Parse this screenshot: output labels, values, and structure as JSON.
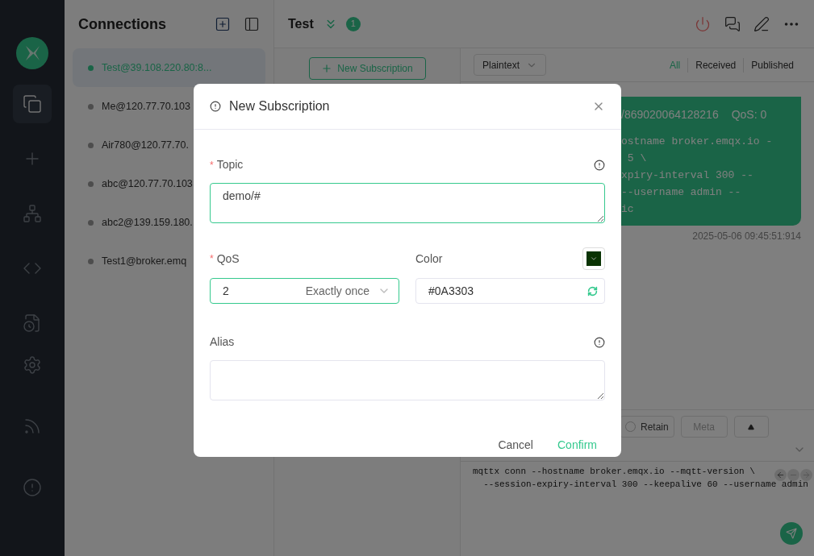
{
  "sidebar": {
    "items": [
      {
        "selected": true
      },
      {
        "selected": false
      },
      {
        "selected": false
      },
      {
        "selected": false
      },
      {
        "selected": false
      },
      {
        "selected": false
      },
      {
        "selected": false
      },
      {
        "selected": false
      }
    ]
  },
  "connections": {
    "title": "Connections",
    "items": [
      {
        "name": "Test@39.108.220.80:8...",
        "connected": true,
        "selected": true
      },
      {
        "name": "Me@120.77.70.103",
        "connected": false,
        "selected": false
      },
      {
        "name": "Air780@120.77.70.",
        "connected": false,
        "selected": false
      },
      {
        "name": "abc@120.77.70.103",
        "connected": false,
        "selected": false
      },
      {
        "name": "abc2@139.159.180.",
        "connected": false,
        "selected": false
      },
      {
        "name": "Test1@broker.emq",
        "connected": false,
        "selected": false
      }
    ]
  },
  "header": {
    "title": "Test",
    "badge": "1"
  },
  "subscriptions": {
    "new_button": "New Subscription"
  },
  "messages": {
    "format": "Plaintext",
    "filters": [
      {
        "label": "All",
        "selected": true
      },
      {
        "label": "Received",
        "selected": false
      },
      {
        "label": "Published",
        "selected": false
      }
    ],
    "bubble": {
      "topic": "/869020064128216",
      "qos": "QoS: 0",
      "lines": [
        "ostname broker.emqx.io -",
        " 5 \\",
        "xpiry-interval 300 --",
        "--username admin --",
        "ic"
      ],
      "time": "2025-05-06 09:45:51:914"
    }
  },
  "composer": {
    "retain": {
      "label": "Retain",
      "checked": false
    },
    "meta": "Meta",
    "code_lines": [
      "mqttx conn --hostname broker.emqx.io --mqtt-version \\",
      "  --session-expiry-interval 300 --keepalive 60 --username admin"
    ]
  },
  "dialog": {
    "title": "New Subscription",
    "required_mark": "*",
    "topic": {
      "label": "Topic",
      "required": true,
      "value": "demo/#"
    },
    "qos": {
      "label": "QoS",
      "required": true,
      "value": "2",
      "description": "Exactly once"
    },
    "color": {
      "label": "Color",
      "value": "#0A3303",
      "color": "#0a3303"
    },
    "alias": {
      "label": "Alias",
      "required": false
    },
    "buttons": [
      {
        "label": "Cancel",
        "kind": "secondary"
      },
      {
        "label": "Confirm",
        "kind": "primary"
      }
    ]
  }
}
